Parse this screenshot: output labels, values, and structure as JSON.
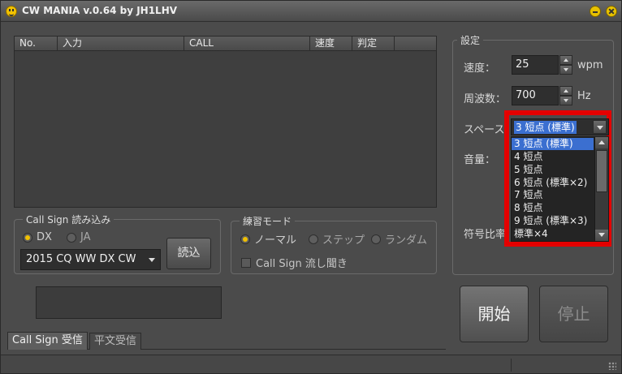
{
  "window": {
    "title": "CW MANIA v.0.64 by JH1LHV"
  },
  "list": {
    "columns": [
      "No.",
      "入力",
      "CALL",
      "速度",
      "判定"
    ]
  },
  "callsign_group": {
    "title": "Call Sign 読み込み",
    "radio_dx": "DX",
    "radio_ja": "JA",
    "selected": "DX",
    "file_value": "2015 CQ WW DX CW",
    "load_button": "読込"
  },
  "practice_group": {
    "title": "練習モード",
    "radio_normal": "ノーマル",
    "radio_step": "ステップ",
    "radio_random": "ランダム",
    "selected": "ノーマル",
    "checkbox_label": "Call Sign 流し聞き"
  },
  "tabs": [
    "Call Sign 受信",
    "平文受信"
  ],
  "settings": {
    "title": "設定",
    "speed_label": "速度：",
    "speed_value": "25",
    "speed_unit": "wpm",
    "freq_label": "周波数：",
    "freq_value": "700",
    "freq_unit": "Hz",
    "space_label": "スペース",
    "space_value": "3 短点 (標準)",
    "volume_label": "音量：",
    "ratio_label": "符号比率",
    "space_options": [
      "3 短点 (標準)",
      "4 短点",
      "5 短点",
      "6 短点 (標準×2)",
      "7 短点",
      "8 短点",
      "9 短点 (標準×3)",
      "標準×4"
    ]
  },
  "controls": {
    "start": "開始",
    "stop": "停止"
  },
  "colors": {
    "highlight": "#e40000",
    "selection": "#3b6fd0",
    "accent": "#f0c000"
  }
}
